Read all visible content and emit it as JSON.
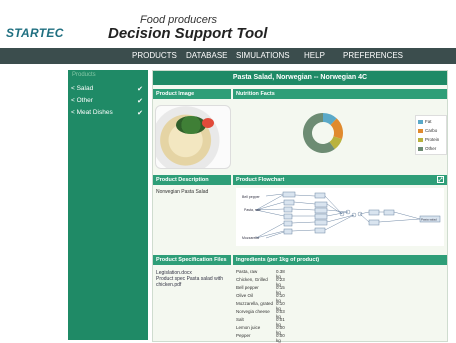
{
  "header": {
    "logo": "STARTEC",
    "subtitle": "Food producers",
    "title": "Decision Support Tool"
  },
  "nav": {
    "items": [
      "PRODUCTS",
      "DATABASE",
      "SIMULATIONS",
      "HELP",
      "PREFERENCES"
    ]
  },
  "sidebar": {
    "top_label": "Products",
    "items": [
      {
        "label": "< Salad"
      },
      {
        "label": "< Other"
      },
      {
        "label": "< Meat Dishes"
      }
    ]
  },
  "main": {
    "title": "Pasta Salad, Norwegian -- Norwegian 4C",
    "panels": {
      "image": "Product Image",
      "nutrition": "Nutrition Facts",
      "description": "Product Description",
      "flowchart": "Product Flowchart",
      "spec_files": "Product Specification Files",
      "ingredients": "Ingredients (per 1kg of product)"
    },
    "description_text": "Norwegian Pasta Salad",
    "spec_files": [
      "Legislation.docx",
      "Product spec Pasta salad with chicken.pdf"
    ],
    "nutrition_legend": [
      {
        "name": "Fat",
        "color": "#5aa9c8",
        "value": 12
      },
      {
        "name": "Carbo",
        "color": "#e08a2e",
        "value": 18
      },
      {
        "name": "Protein",
        "color": "#b9b23d",
        "value": 10
      },
      {
        "name": "Other",
        "color": "#6d8c73",
        "value": 60
      }
    ],
    "ingredients": [
      {
        "name": "Pasta, raw",
        "qty": "0.38 kg"
      },
      {
        "name": "Chicken, Grilled",
        "qty": "0.23 kg"
      },
      {
        "name": "Bell pepper",
        "qty": "0.15 kg"
      },
      {
        "name": "Olive Oil",
        "qty": "0.10 kg"
      },
      {
        "name": "Mozzarella, grated",
        "qty": "0.10 kg"
      },
      {
        "name": "Norvegia cheese",
        "qty": "0.03 kg"
      },
      {
        "name": "Salt",
        "qty": "0.01 kg"
      },
      {
        "name": "Lemon juice",
        "qty": "0.00 kg"
      },
      {
        "name": "Pepper",
        "qty": "0.00 kg"
      }
    ],
    "flowchart_labels": [
      "Pasta, raw",
      "Bell pepper",
      "Mozzarella",
      "Pasta salad"
    ]
  }
}
